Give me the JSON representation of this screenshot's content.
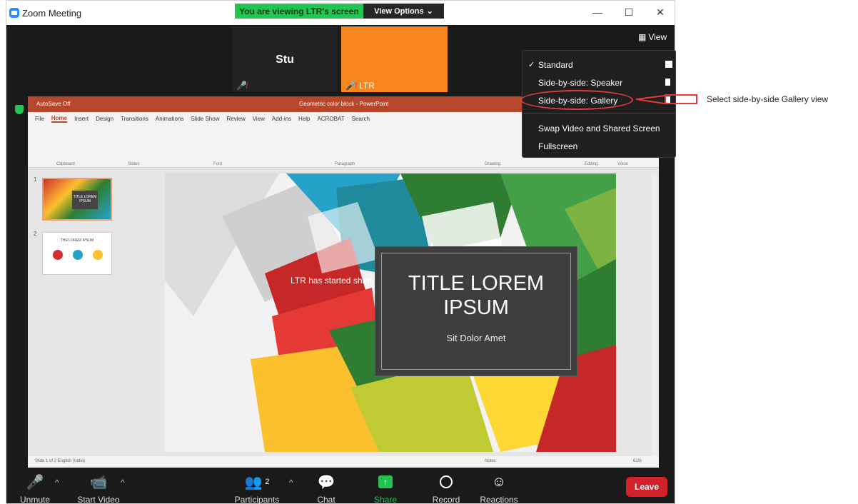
{
  "window": {
    "app_title": "Zoom Meeting",
    "minimize": "—",
    "maximize": "☐",
    "close": "✕"
  },
  "banner": {
    "viewing": "You are viewing LTR's screen",
    "view_options": "View Options",
    "caret": "⌄"
  },
  "tiles": [
    {
      "name": "Stu"
    },
    {
      "name": "LTR"
    }
  ],
  "view_button": {
    "label": "View"
  },
  "view_menu": {
    "items": [
      {
        "label": "Standard",
        "checked": true
      },
      {
        "label": "Side-by-side: Speaker",
        "checked": false
      },
      {
        "label": "Side-by-side: Gallery",
        "checked": false
      },
      {
        "label": "Swap Video and Shared Screen",
        "checked": false
      },
      {
        "label": "Fullscreen",
        "checked": false
      }
    ],
    "check_mark": "✓"
  },
  "annotation": {
    "text": "Select side-by-side Gallery view"
  },
  "shared": {
    "titlebar_left": "AutoSave  Off",
    "titlebar_center": "Geometric color block  -  PowerPoint",
    "ribbon_tabs": [
      "File",
      "Home",
      "Insert",
      "Design",
      "Transitions",
      "Animations",
      "Slide Show",
      "Review",
      "View",
      "Add-ins",
      "Help",
      "ACROBAT",
      "Search"
    ],
    "ribbon_groups": [
      "Clipboard",
      "Slides",
      "Font",
      "Paragraph",
      "Drawing",
      "Editing",
      "Voice"
    ],
    "thumb1_title": "TITLE LOREM IPSUM",
    "thumb2_title": "THE LOREM IPSUM",
    "slide_nums": [
      "1",
      "2"
    ],
    "slide_title": "TITLE LOREM IPSUM",
    "slide_subtitle": "Sit Dolor Amet",
    "share_message": "LTR has started         sharing",
    "status_left": "Slide 1 of 2    English (India)",
    "status_right": "Notes",
    "zoom_pct": "61%"
  },
  "toolbar": {
    "unmute": "Unmute",
    "start_video": "Start Video",
    "participants": "Participants",
    "participants_count": "2",
    "chat": "Chat",
    "share_screen": "Share Screen",
    "record": "Record",
    "reactions": "Reactions",
    "leave": "Leave",
    "caret": "^"
  },
  "colors": {
    "accent_green": "#23c552",
    "leave_red": "#d1222c",
    "tile_orange": "#f7861c",
    "ppt_red": "#b7472a",
    "annotation_red": "#e03b3b"
  }
}
